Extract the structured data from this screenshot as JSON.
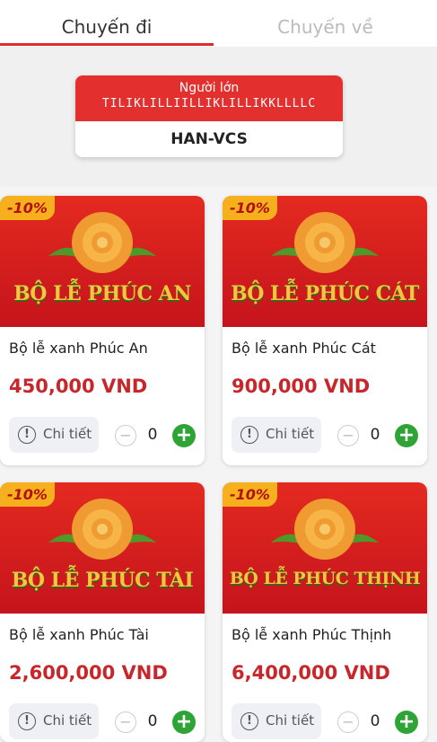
{
  "tabs": {
    "outbound": "Chuyến đi",
    "return": "Chuyến về"
  },
  "passenger": {
    "type": "Người lớn",
    "name": "TILIKLILLIILLIKLILLIKKLLLLC",
    "route": "HAN-VCS"
  },
  "products": [
    {
      "discount": "-10%",
      "banner": "BỘ LỄ PHÚC AN",
      "name": "Bộ lễ xanh Phúc An",
      "price": "450,000 VND",
      "detail": "Chi tiết",
      "qty": "0"
    },
    {
      "discount": "-10%",
      "banner": "BỘ LỄ PHÚC CÁT",
      "name": "Bộ lễ xanh Phúc Cát",
      "price": "900,000 VND",
      "detail": "Chi tiết",
      "qty": "0"
    },
    {
      "discount": "-10%",
      "banner": "BỘ LỄ PHÚC TÀI",
      "name": "Bộ lễ xanh Phúc Tài",
      "price": "2,600,000 VND",
      "detail": "Chi tiết",
      "qty": "0"
    },
    {
      "discount": "-10%",
      "banner": "BỘ LỄ PHÚC THỊNH",
      "name": "Bộ lễ xanh Phúc Thịnh",
      "price": "6,400,000 VND",
      "detail": "Chi tiết",
      "qty": "0"
    }
  ],
  "colors": {
    "brand": "#e3302f",
    "price": "#c8262a",
    "add": "#2fa436",
    "badge": "#f6b01e"
  }
}
